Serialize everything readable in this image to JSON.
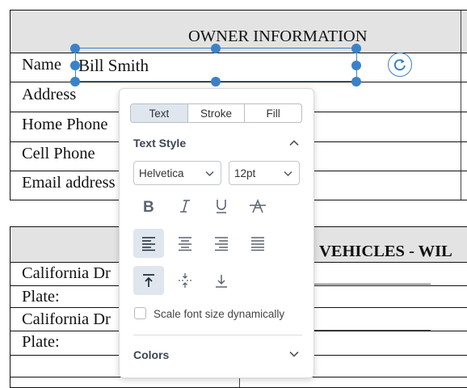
{
  "document": {
    "owner_table": {
      "title": "OWNER INFORMATION",
      "rows": [
        "Name",
        "Address",
        "Home Phone",
        "Cell Phone",
        "Email address"
      ]
    },
    "vehicles_table": {
      "title": "VEHICLES - WIL",
      "rows": [
        "California Dr",
        "Plate:",
        "California Dr",
        "Plate:"
      ]
    }
  },
  "annotation": {
    "text": "Bill Smith"
  },
  "style_panel": {
    "tabs": [
      "Text",
      "Stroke",
      "Fill"
    ],
    "active_tab": "Text",
    "text_style": {
      "heading": "Text Style",
      "font": "Helvetica",
      "size": "12pt",
      "decorations": [
        "bold-icon",
        "italic-icon",
        "underline-icon",
        "strikethrough-icon"
      ],
      "horizontal_align": [
        "align-left-icon",
        "align-center-icon",
        "align-right-icon",
        "align-justify-icon"
      ],
      "active_horizontal_align": "align-left",
      "vertical_align": [
        "align-top-icon",
        "align-middle-icon",
        "align-bottom-icon"
      ],
      "active_vertical_align": "align-top",
      "scale_checkbox_label": "Scale font size dynamically",
      "scale_checked": false
    },
    "colors": {
      "heading": "Colors",
      "expanded": false
    }
  },
  "theme": {
    "accent": "#3a82c8",
    "header_bg": "#e3e3e3",
    "active_button_bg": "#dfe6ee"
  }
}
